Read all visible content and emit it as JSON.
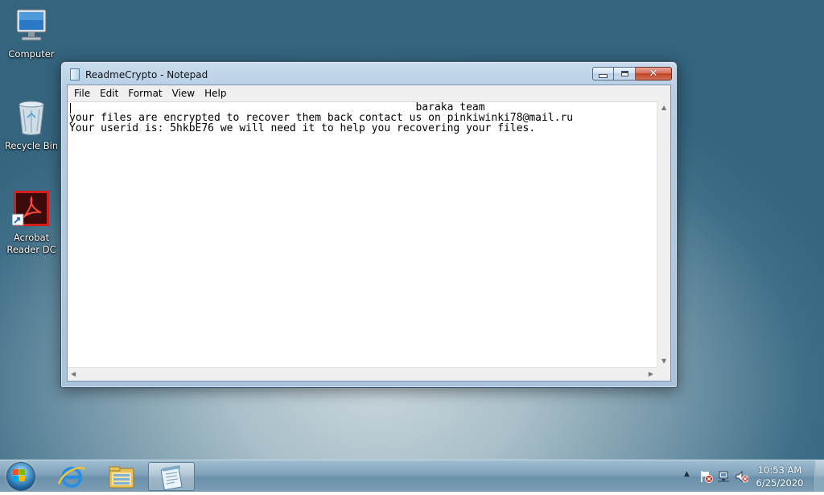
{
  "desktop": {
    "icons": [
      {
        "label": "Computer"
      },
      {
        "label": "Recycle Bin"
      },
      {
        "label": "Acrobat Reader DC"
      }
    ]
  },
  "notepad": {
    "title": "ReadmeCrypto - Notepad",
    "menu": [
      "File",
      "Edit",
      "Format",
      "View",
      "Help"
    ],
    "lines": [
      "                                                       baraka team",
      "your files are encrypted to recover them back contact us on pinkiwinki78@mail.ru",
      "Your userid is: 5hkbE76 we will need it to help you recovering your files."
    ],
    "caption_buttons": {
      "minimize_icon": "minimize-icon",
      "maximize_icon": "maximize-icon",
      "close_glyph": "✕"
    }
  },
  "taskbar": {
    "start_icon": "windows-flag-icon",
    "pinned": [
      {
        "icon": "internet-explorer-icon"
      },
      {
        "icon": "windows-explorer-icon"
      },
      {
        "icon": "notepad-icon",
        "active": true
      }
    ],
    "tray": {
      "show_hidden_glyph": "▲",
      "icons": [
        "action-center-flag-icon",
        "network-icon",
        "volume-muted-icon"
      ],
      "time": "10:53 AM",
      "date": "6/25/2020"
    }
  },
  "colors": {
    "desktop_center": "#c9d6dc",
    "desktop_edge": "#34647e",
    "close_button": "#c2401f",
    "window_frame": "#a9c3dc"
  }
}
